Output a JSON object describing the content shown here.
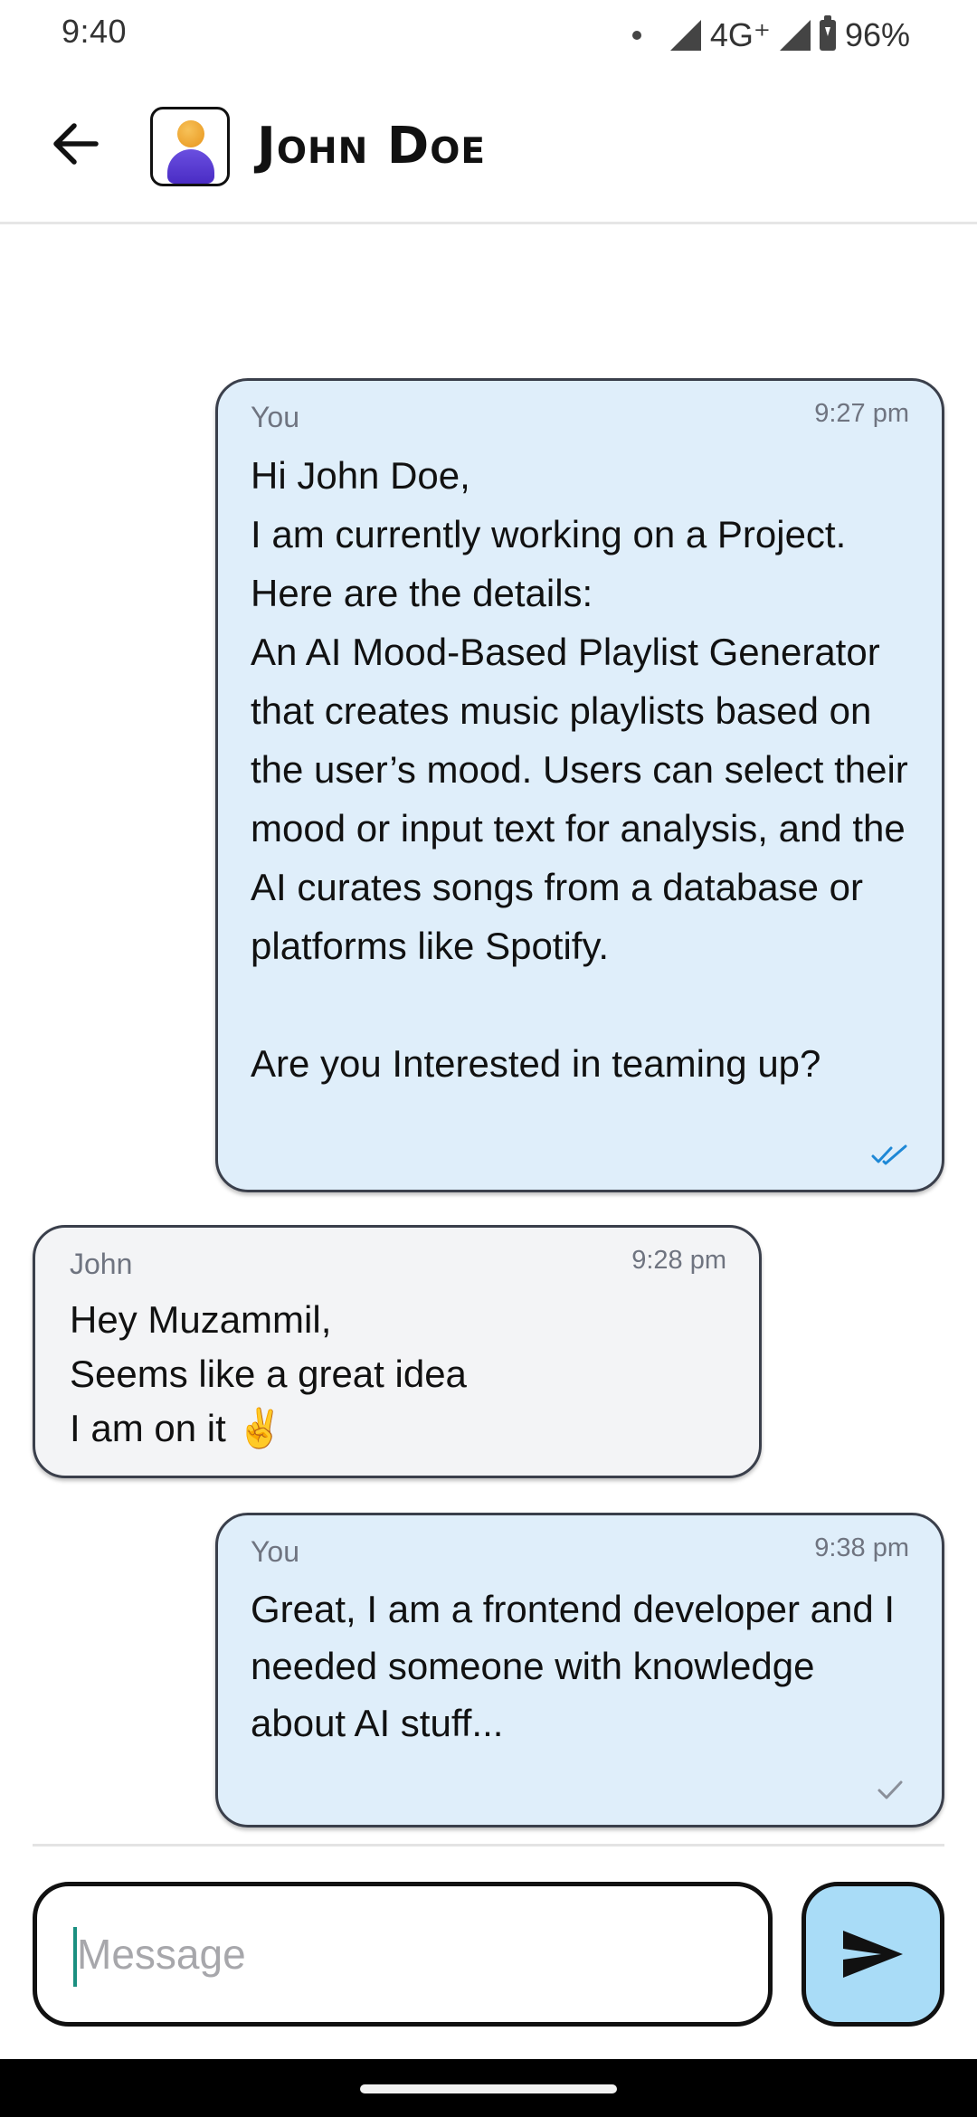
{
  "status_bar": {
    "time": "9:40",
    "network": "4G⁺",
    "battery": "96%"
  },
  "header": {
    "contact_name": "John Doe",
    "back_icon": "arrow-left-icon",
    "avatar_icon": "person-avatar-icon"
  },
  "messages": [
    {
      "sender": "You",
      "time": "9:27 pm",
      "text": "Hi John Doe,\nI am currently working on a Project. Here are the details:\nAn AI Mood-Based Playlist Generator that creates music playlists based on the user’s mood. Users can select their mood or input text for analysis, and the AI curates songs from a database or platforms like Spotify.\n\nAre you Interested in teaming up?",
      "status_icon": "double-check-icon",
      "status_color": "#1e88d6"
    },
    {
      "sender": "John",
      "time": "9:28 pm",
      "text": "Hey Muzammil,\nSeems like a great idea\nI am on it ✌️"
    },
    {
      "sender": "You",
      "time": "9:38 pm",
      "text": "Great, I am a frontend developer and I needed someone with knowledge about AI stuff...",
      "status_icon": "check-icon",
      "status_color": "#8a8f99"
    }
  ],
  "composer": {
    "placeholder": "Message",
    "value": "",
    "send_icon": "send-icon"
  },
  "colors": {
    "outgoing_bubble": "#dfeefa",
    "incoming_bubble": "#f3f4f6",
    "send_button": "#a9dcf7"
  }
}
